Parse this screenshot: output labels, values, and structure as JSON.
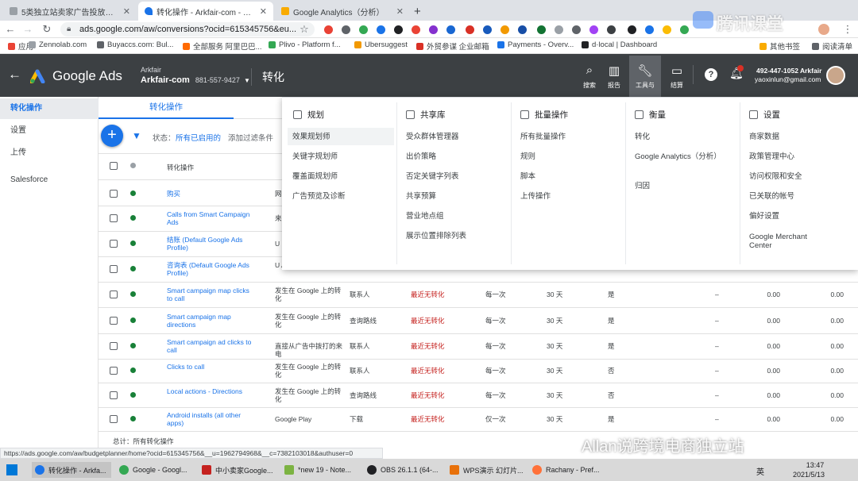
{
  "browser": {
    "tabs": [
      {
        "title": "5类独立站卖家广告投放课程",
        "color": "#9aa0a6"
      },
      {
        "title": "转化操作 - Arkfair-com - Goog",
        "color": "#1a73e8"
      },
      {
        "title": "Google Analytics（分析）",
        "color": "#f9ab00"
      }
    ],
    "new_tab": "+",
    "url": "ads.google.com/aw/conversions?ocid=615345756&eu...",
    "bookmarks": [
      "应用",
      "Zennolab.com",
      "Buyaccs.com: Bul...",
      "全部服务 阿里巴巴...",
      "Plivo - Platform f...",
      "Ubersuggest",
      "外贸参谋 企业邮箱",
      "Payments - Overv...",
      "d·local | Dashboard",
      "其他书签",
      "阅读清单"
    ]
  },
  "header": {
    "product": "Google Ads",
    "account_label": "Arkfair",
    "account_name": "Arkfair-com",
    "account_id": "881-557-9427",
    "page_title": "转化",
    "icons": [
      {
        "name": "search",
        "label": "搜索",
        "glyph": "⌕"
      },
      {
        "name": "reports",
        "label": "报告",
        "glyph": "▥"
      },
      {
        "name": "tools",
        "label": "工具与",
        "glyph": "🔧"
      },
      {
        "name": "billing",
        "label": "结算",
        "glyph": "▭"
      }
    ],
    "help": "?",
    "user_phone": "492-447-1052 Arkfair",
    "user_email": "yaoxinlun@gmail.com"
  },
  "sidebar": {
    "items": [
      "转化操作",
      "设置",
      "上传",
      "Salesforce"
    ]
  },
  "main": {
    "subtab": "转化操作",
    "filter_status": "状态：",
    "filter_value": "所有已启用的",
    "add_filter": "添加过滤条件",
    "col_header": "转化操作",
    "rows": [
      {
        "name": "购买",
        "source": "网",
        "cat": "",
        "status": "",
        "count": "",
        "window": "",
        "incl": "",
        "v1": "",
        "v2": ""
      },
      {
        "name": "Calls from Smart Campaign Ads",
        "source": "来",
        "cat": "",
        "status": "",
        "count": "",
        "window": "",
        "incl": "",
        "v1": "",
        "v2": ""
      },
      {
        "name": "结账 (Default Google Ads Profile)",
        "source": "U",
        "cat": "",
        "status": "",
        "count": "",
        "window": "",
        "incl": "",
        "v1": "",
        "v2": ""
      },
      {
        "name": "咨询表 (Default Google Ads Profile)",
        "source": "U Analytics（分析）",
        "cat": "",
        "status": "",
        "count": "",
        "window": "",
        "incl": "",
        "v1": "",
        "v2": ""
      },
      {
        "name": "Smart campaign map clicks to call",
        "source": "发生在 Google 上的转化",
        "cat": "联系人",
        "status": "最近无转化",
        "count": "每一次",
        "window": "30 天",
        "incl": "是",
        "v1": "0.00",
        "v2": "0.00"
      },
      {
        "name": "Smart campaign map directions",
        "source": "发生在 Google 上的转化",
        "cat": "查询路线",
        "status": "最近无转化",
        "count": "每一次",
        "window": "30 天",
        "incl": "是",
        "v1": "0.00",
        "v2": "0.00"
      },
      {
        "name": "Smart campaign ad clicks to call",
        "source": "直接从广告中拨打的来电",
        "cat": "联系人",
        "status": "最近无转化",
        "count": "每一次",
        "window": "30 天",
        "incl": "是",
        "v1": "0.00",
        "v2": "0.00"
      },
      {
        "name": "Clicks to call",
        "source": "发生在 Google 上的转化",
        "cat": "联系人",
        "status": "最近无转化",
        "count": "每一次",
        "window": "30 天",
        "incl": "否",
        "v1": "0.00",
        "v2": "0.00"
      },
      {
        "name": "Local actions - Directions",
        "source": "发生在 Google 上的转化",
        "cat": "查询路线",
        "status": "最近无转化",
        "count": "每一次",
        "window": "30 天",
        "incl": "否",
        "v1": "0.00",
        "v2": "0.00"
      },
      {
        "name": "Android installs (all other apps)",
        "source": "Google Play",
        "cat": "下载",
        "status": "最近无转化",
        "count": "仅一次",
        "window": "30 天",
        "incl": "是",
        "v1": "0.00",
        "v2": "0.00"
      }
    ],
    "total": "总计：所有转化操作"
  },
  "menu": {
    "columns": [
      {
        "title": "规划",
        "items": [
          "效果规划师",
          "关键字规划师",
          "覆盖面规划师",
          "广告预览及诊断"
        ]
      },
      {
        "title": "共享库",
        "items": [
          "受众群体管理器",
          "出价策略",
          "否定关键字列表",
          "共享预算",
          "营业地点组",
          "展示位置排除列表"
        ]
      },
      {
        "title": "批量操作",
        "items": [
          "所有批量操作",
          "规则",
          "脚本",
          "上传操作"
        ]
      },
      {
        "title": "衡量",
        "items": [
          "转化",
          "Google Analytics（分析）",
          "归因"
        ]
      },
      {
        "title": "设置",
        "items": [
          "商家数据",
          "政策管理中心",
          "访问权限和安全",
          "已关联的帐号",
          "偏好设置",
          "Google Merchant Center"
        ]
      }
    ]
  },
  "status_url": "https://ads.google.com/aw/budgetplanner/home?ocid=615345756&__u=1962794968&__c=7382103018&authuser=0",
  "taskbar": {
    "tasks": [
      "转化操作 - Arkfa...",
      "Google - Googl...",
      "中小卖家Google...",
      "*new 19 - Note...",
      "OBS 26.1.1 (64-...",
      "WPS演示 幻灯片...",
      "Rachany - Pref..."
    ],
    "ime": "英",
    "time": "13:47",
    "date": "2021/5/13"
  },
  "watermarks": {
    "top": "腾讯课堂",
    "bottom": "Allan说跨境电商独立站"
  }
}
